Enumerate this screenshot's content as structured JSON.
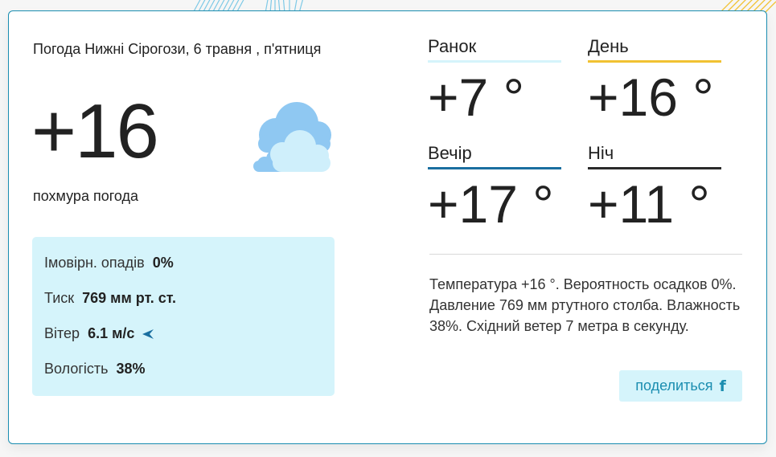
{
  "location_title": "Погода Нижні Сірогози, 6 травня , п'ятниця",
  "current": {
    "temperature": "+16",
    "condition": "похмура погода",
    "icon": "cloudy-icon"
  },
  "details": {
    "precip_label": "Імовірн. опадів",
    "precip_value": "0%",
    "pressure_label": "Тиск",
    "pressure_value": "769 мм рт. ст.",
    "wind_label": "Вітер",
    "wind_value": "6.1 м/с",
    "wind_icon": "wind-direction-arrow-icon",
    "humidity_label": "Вологість",
    "humidity_value": "38%"
  },
  "periods": [
    {
      "label": "Ранок",
      "temp": "+7 °",
      "color": "#d5f4fb"
    },
    {
      "label": "День",
      "temp": "+16 °",
      "color": "#f1c232"
    },
    {
      "label": "Вечір",
      "temp": "+17 °",
      "color": "#1a6fa0"
    },
    {
      "label": "Ніч",
      "temp": "+11 °",
      "color": "#2a2a2a"
    }
  ],
  "summary": "Температура +16 °. Вероятность осадков 0%. Давление 769 мм ртутного столба. Влажность 38%. Східний ветер 7 метра в секунду.",
  "share": {
    "label": "поделиться",
    "icon": "facebook-icon"
  },
  "colors": {
    "accent": "#1a8db0",
    "panel": "#d5f4fb",
    "cloud_dark": "#8fc8f2",
    "cloud_light": "#cfeffb"
  }
}
